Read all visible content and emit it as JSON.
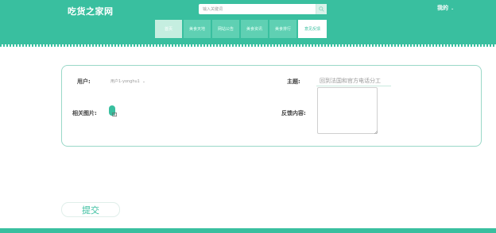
{
  "header": {
    "logo": "吃货之家网",
    "search": {
      "placeholder": "输入关键词"
    },
    "user_label": "我的",
    "user_caret": "⌄",
    "nav": [
      "首页",
      "美食天地",
      "网站公告",
      "美食资讯",
      "美食排行",
      "意见反馈"
    ]
  },
  "form": {
    "user_label": "用户:",
    "user_value": "用户1-yonghu1",
    "user_caret": "⌄",
    "subject_label": "主题:",
    "subject_value": "回到法国和官方电话分工",
    "image_label": "相关图片:",
    "content_label": "反馈内容:",
    "content_value": ""
  },
  "submit_label": "提交",
  "colors": {
    "brand": "#39bf9f",
    "nav_item": "#5fd0b3",
    "nav_active_text": "#39bf9f"
  },
  "icons": {
    "search": "search-icon",
    "upload": "upload-icon",
    "resize": "resize-icon"
  }
}
